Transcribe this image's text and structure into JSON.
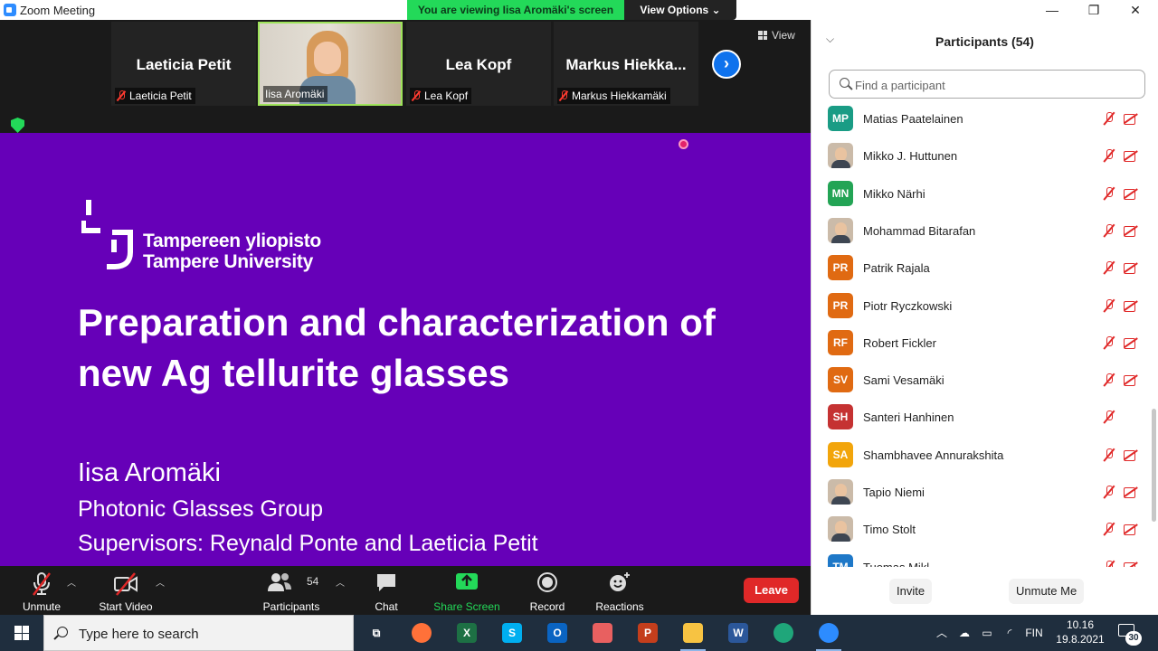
{
  "window": {
    "title": "Zoom Meeting",
    "viewing_banner": "You are viewing Iisa Aromäki's screen",
    "view_options": "View Options ⌄",
    "minimize": "—",
    "restore": "❐",
    "close": "✕"
  },
  "thumbnails": [
    {
      "big_name": "Laeticia Petit",
      "label": "Laeticia Petit",
      "muted": true,
      "video": false
    },
    {
      "big_name": "",
      "label": "Iisa Aromäki",
      "muted": false,
      "video": true
    },
    {
      "big_name": "Lea Kopf",
      "label": "Lea Kopf",
      "muted": true,
      "video": false
    },
    {
      "big_name": "Markus  Hiekka...",
      "label": "Markus Hiekkamäki",
      "muted": true,
      "video": false
    }
  ],
  "view_button": "View",
  "slide": {
    "university_fi": "Tampereen yliopisto",
    "university_en": "Tampere University",
    "title": "Preparation and characterization of new Ag tellurite glasses",
    "author": "Iisa Aromäki",
    "group": "Photonic Glasses Group",
    "supervisors": "Supervisors: Reynald Ponte and Laeticia Petit",
    "background_color": "#6600b8"
  },
  "toolbar": {
    "unmute": "Unmute",
    "start_video": "Start Video",
    "participants": "Participants",
    "participants_count": "54",
    "chat": "Chat",
    "share_screen": "Share Screen",
    "record": "Record",
    "reactions": "Reactions",
    "leave": "Leave"
  },
  "panel": {
    "title": "Participants (54)",
    "search_placeholder": "Find a participant",
    "participants": [
      {
        "initials": "MP",
        "name": "Matias Paatelainen",
        "color": "#1a9c85",
        "photo": false,
        "cam": true
      },
      {
        "initials": "",
        "name": "Mikko J. Huttunen",
        "color": "",
        "photo": true,
        "cam": true
      },
      {
        "initials": "MN",
        "name": "Mikko Närhi",
        "color": "#23a455",
        "photo": false,
        "cam": true
      },
      {
        "initials": "",
        "name": "Mohammad Bitarafan",
        "color": "",
        "photo": true,
        "cam": true
      },
      {
        "initials": "PR",
        "name": "Patrik Rajala",
        "color": "#e06a12",
        "photo": false,
        "cam": true
      },
      {
        "initials": "PR",
        "name": "Piotr Ryczkowski",
        "color": "#e06a12",
        "photo": false,
        "cam": true
      },
      {
        "initials": "RF",
        "name": "Robert Fickler",
        "color": "#e06a12",
        "photo": false,
        "cam": true
      },
      {
        "initials": "SV",
        "name": "Sami Vesamäki",
        "color": "#e06a12",
        "photo": false,
        "cam": true
      },
      {
        "initials": "SH",
        "name": "Santeri Hanhinen",
        "color": "#c53232",
        "photo": false,
        "cam": false
      },
      {
        "initials": "SA",
        "name": "Shambhavee Annurakshita",
        "color": "#f2a50b",
        "photo": false,
        "cam": true
      },
      {
        "initials": "",
        "name": "Tapio Niemi",
        "color": "",
        "photo": true,
        "cam": true
      },
      {
        "initials": "",
        "name": "Timo Stolt",
        "color": "",
        "photo": true,
        "cam": true
      },
      {
        "initials": "TM",
        "name": "Tuomas Mikl...",
        "color": "#1e78c8",
        "photo": false,
        "cam": true
      }
    ],
    "invite": "Invite",
    "unmute_me": "Unmute Me"
  },
  "taskbar": {
    "search_placeholder": "Type here to search",
    "apps": [
      {
        "name": "task-view",
        "glyph": "⧉",
        "color": "transparent"
      },
      {
        "name": "firefox",
        "glyph": "",
        "color": "#ff7139"
      },
      {
        "name": "excel",
        "glyph": "X",
        "color": "#1d7044"
      },
      {
        "name": "skype",
        "glyph": "S",
        "color": "#00aff0"
      },
      {
        "name": "outlook",
        "glyph": "O",
        "color": "#0a64c2"
      },
      {
        "name": "paint",
        "glyph": "",
        "color": "#e86060"
      },
      {
        "name": "powerpoint",
        "glyph": "P",
        "color": "#c43e1c"
      },
      {
        "name": "file-explorer",
        "glyph": "",
        "color": "#f7c342"
      },
      {
        "name": "word",
        "glyph": "W",
        "color": "#2b579a"
      },
      {
        "name": "edge",
        "glyph": "",
        "color": "#1fa67a"
      },
      {
        "name": "zoom",
        "glyph": "",
        "color": "#2d8cff"
      }
    ],
    "language": "FIN",
    "time": "10.16",
    "date": "19.8.2021",
    "notification_count": "30"
  }
}
